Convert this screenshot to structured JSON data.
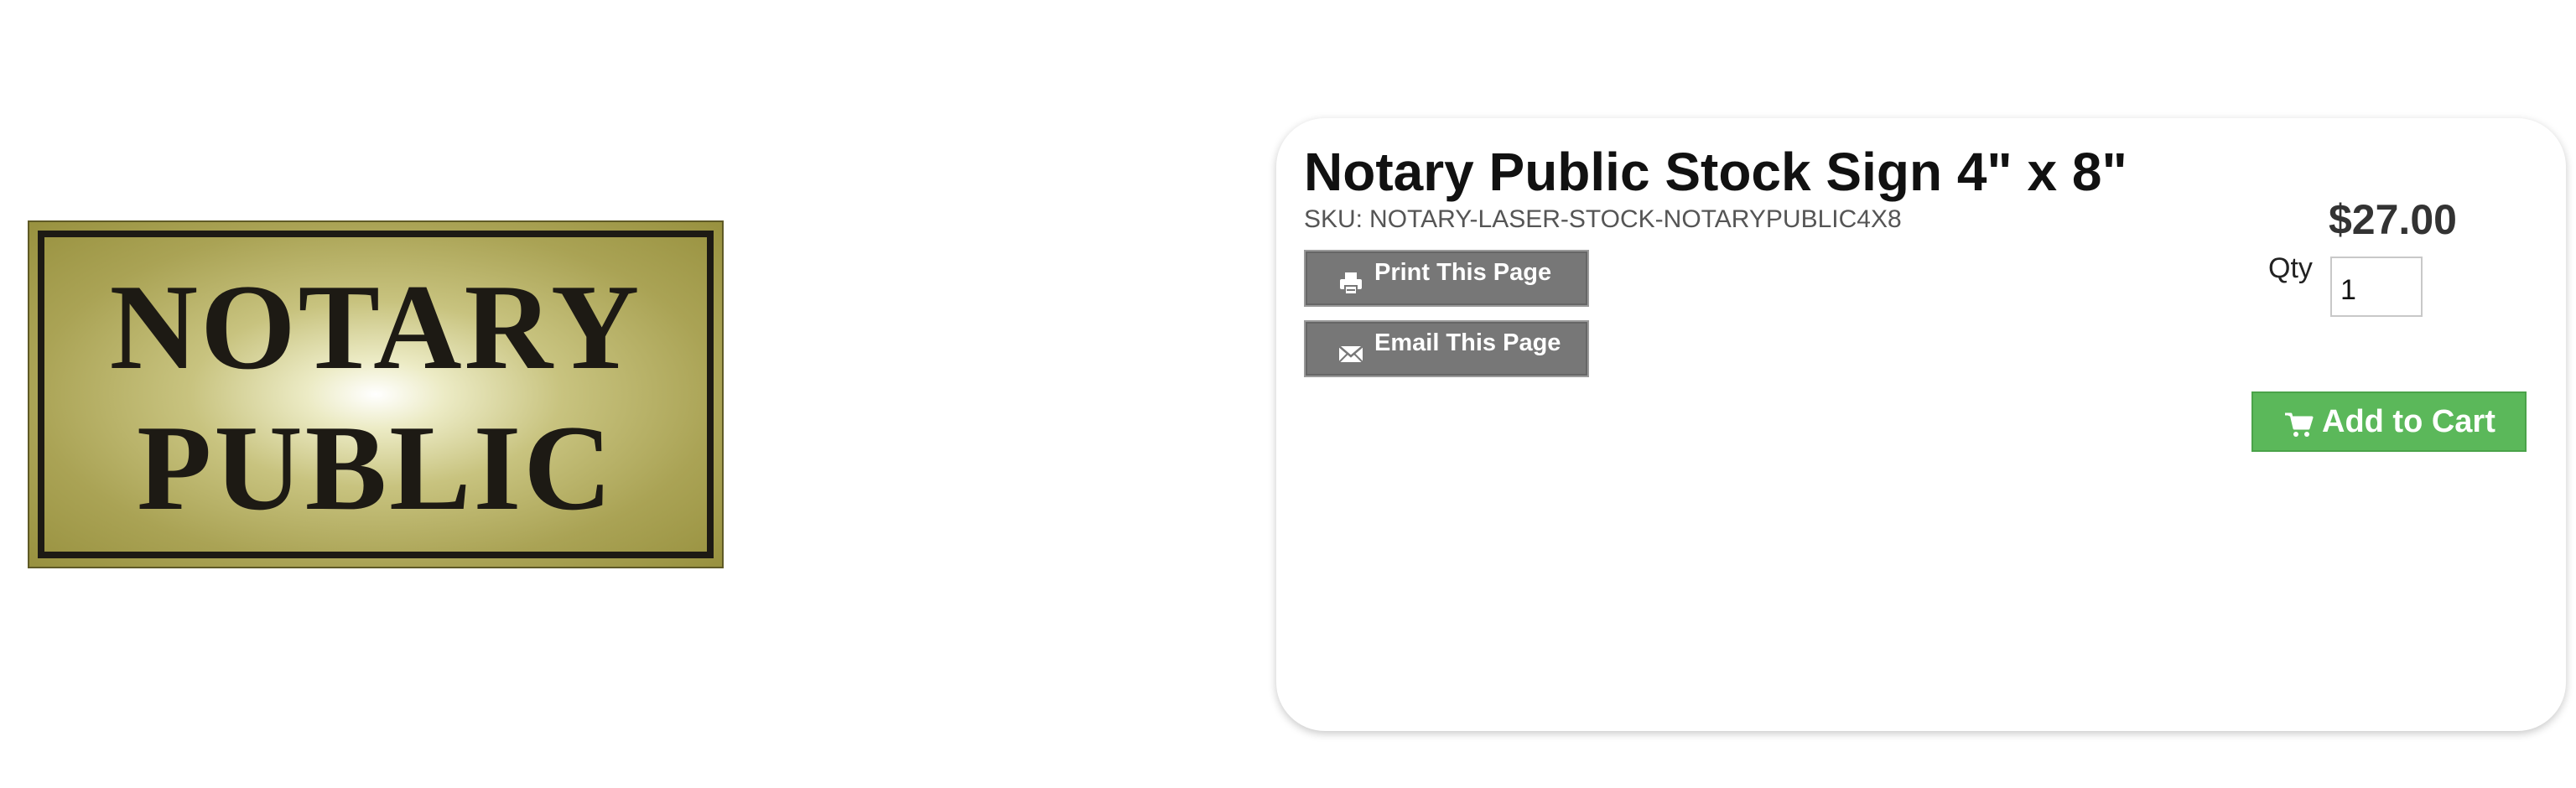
{
  "product_image": {
    "line_1": "NOTARY",
    "line_2": "PUBLIC",
    "colors": {
      "plate_light": "#ecebc5",
      "plate_dark": "#98913f",
      "text": "#1d1a14"
    }
  },
  "product": {
    "title": "Notary Public Stock Sign 4\" x 8\"",
    "sku_label": "SKU:",
    "sku_value": "NOTARY-LASER-STOCK-NOTARYPUBLIC4X8",
    "price": "$27.00"
  },
  "actions": {
    "print_label": "Print This Page",
    "print_icon": "printer-icon",
    "email_label": "Email This Page",
    "email_icon": "envelope-icon"
  },
  "cart": {
    "qty_label": "Qty",
    "qty_value": "1",
    "add_label": "Add to Cart",
    "add_icon": "cart-icon",
    "button_color": "#5bb85a"
  }
}
